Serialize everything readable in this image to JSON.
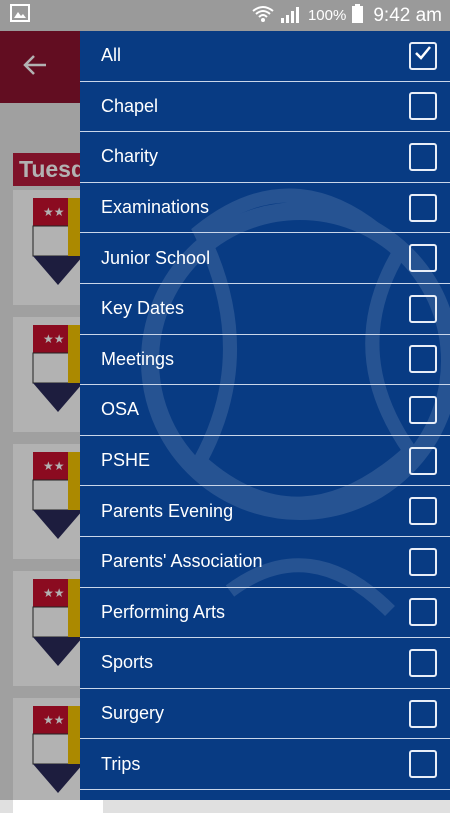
{
  "status_bar": {
    "battery_percent": "100%",
    "time": "9:42 am"
  },
  "background": {
    "day_header": "Tuesday"
  },
  "filters": [
    {
      "label": "All",
      "checked": true
    },
    {
      "label": "Chapel",
      "checked": false
    },
    {
      "label": "Charity",
      "checked": false
    },
    {
      "label": "Examinations",
      "checked": false
    },
    {
      "label": "Junior School",
      "checked": false
    },
    {
      "label": "Key Dates",
      "checked": false
    },
    {
      "label": "Meetings",
      "checked": false
    },
    {
      "label": "OSA",
      "checked": false
    },
    {
      "label": "PSHE",
      "checked": false
    },
    {
      "label": "Parents Evening",
      "checked": false
    },
    {
      "label": "Parents' Association",
      "checked": false
    },
    {
      "label": "Performing Arts",
      "checked": false
    },
    {
      "label": "Sports",
      "checked": false
    },
    {
      "label": "Surgery",
      "checked": false
    },
    {
      "label": "Trips",
      "checked": false
    }
  ],
  "colors": {
    "drawer": "#083b83",
    "app_bar": "#8d1330",
    "day_header": "#b71b3c"
  }
}
